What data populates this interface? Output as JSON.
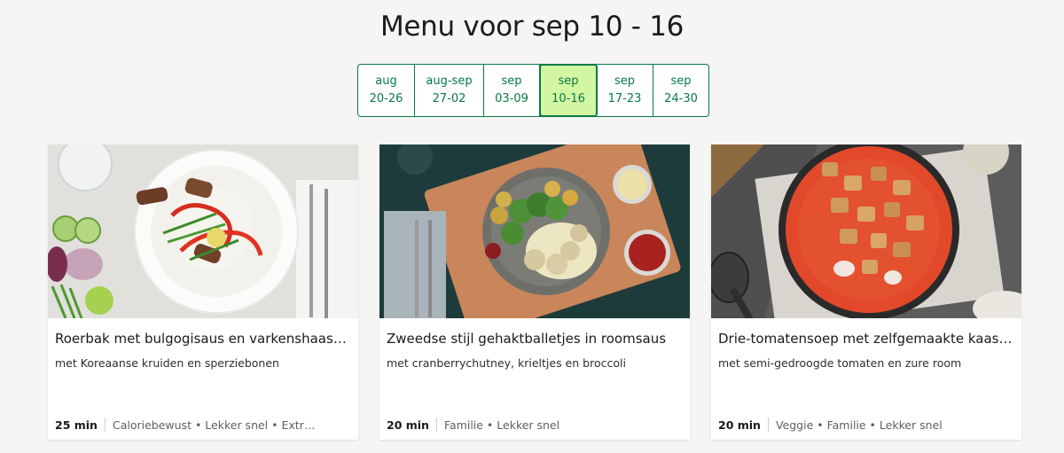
{
  "page": {
    "title": "Menu voor sep 10 - 16"
  },
  "weeks": [
    {
      "month": "aug",
      "range": "20-26",
      "active": false
    },
    {
      "month": "aug-sep",
      "range": "27-02",
      "active": false
    },
    {
      "month": "sep",
      "range": "03-09",
      "active": false
    },
    {
      "month": "sep",
      "range": "10-16",
      "active": true
    },
    {
      "month": "sep",
      "range": "17-23",
      "active": false
    },
    {
      "month": "sep",
      "range": "24-30",
      "active": false
    }
  ],
  "recipes": [
    {
      "name": "Roerbak met bulgogisaus en varkenshaaspunten",
      "subtitle": "met Koreaanse kruiden en sperziebonen",
      "time": "25 min",
      "tags": "Caloriebewust • Lekker snel • Extra veel groenten"
    },
    {
      "name": "Zweedse stijl gehaktballetjes in roomsaus",
      "subtitle": "met cranberrychutney, krieltjes en broccoli",
      "time": "20 min",
      "tags": "Familie • Lekker snel"
    },
    {
      "name": "Drie-tomatensoep met zelfgemaakte kaascroutons",
      "subtitle": "met semi-gedroogde tomaten en zure room",
      "time": "20 min",
      "tags": "Veggie • Familie • Lekker snel"
    }
  ],
  "colors": {
    "accent": "#067a46",
    "active_week_bg": "#d3f6a3",
    "page_bg": "#f5f5f3"
  }
}
